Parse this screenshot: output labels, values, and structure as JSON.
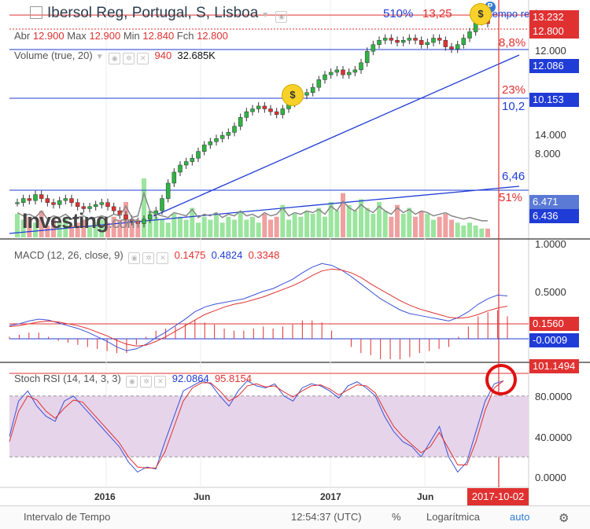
{
  "header": {
    "symbol": "Ibersol Reg, Portugal, S, Lisboa",
    "ohlc": {
      "open_label": "Abr",
      "open": "12.900",
      "high_label": "Max",
      "high": "12.900",
      "low_label": "Min",
      "low": "12.840",
      "close_label": "Fch",
      "close": "12.800"
    },
    "realtime_label": "tempo real",
    "signal_blue": "510%",
    "signal_red": "13,25"
  },
  "volume_study": {
    "label": "Volume (true, 20)",
    "value1": "940",
    "value2": "32.685K"
  },
  "macd_study": {
    "label": "MACD (12, 26, close, 9)",
    "v1": "0.1475",
    "v2": "0.4824",
    "v3": "0.3348"
  },
  "rsi_study": {
    "label": "Stoch RSI (14, 14, 3, 3)",
    "v1": "92.0864",
    "v2": "95.8154"
  },
  "price_annotations": {
    "pct88": "8,8%",
    "pct23": "23%",
    "lvl102": "10,2",
    "lvl646": "6,46",
    "pct51": "51%"
  },
  "price_tags": {
    "t1": "13.232",
    "t2": "12.800",
    "t3": "12.086",
    "t4": "10.153",
    "t5": "6.471",
    "t6": "6.436"
  },
  "price_scale": [
    "14.000",
    "8.000"
  ],
  "price_scale_top": "12.000",
  "macd_scale": [
    "1.0000",
    "0.5000"
  ],
  "macd_tags": {
    "t1": "0.1560",
    "t2": "-0.0009"
  },
  "rsi_scale": [
    "80.0000",
    "40.0000",
    "0.0000"
  ],
  "rsi_tag": "101.1494",
  "x_axis": {
    "labels": [
      "2016",
      "Jun",
      "2017",
      "Jun"
    ],
    "date_tag": "2017-10-02"
  },
  "footer": {
    "interval": "Intervalo de Tempo",
    "time": "12:54:37 (UTC)",
    "percent": "%",
    "log": "Logarítmica",
    "auto": "auto"
  },
  "logo": {
    "main": "Investing",
    "suffix": ".com"
  },
  "colors": {
    "up": "#2fb344",
    "down": "#e03131",
    "blue": "#1f3cd6",
    "macd_line": "#3a52d9",
    "signal_line": "#e03131",
    "rsi_fill": "#e6d4ea"
  },
  "chart_data": {
    "type": "candlestick",
    "title": "Ibersol Reg, Portugal, S, Lisboa",
    "x_range": [
      "2015-09",
      "2017-10-02"
    ],
    "price": [
      6.4,
      6.5,
      6.45,
      6.6,
      6.5,
      6.4,
      6.35,
      6.45,
      6.5,
      6.4,
      6.3,
      6.25,
      6.3,
      6.35,
      6.4,
      6.3,
      6.2,
      6.1,
      6.0,
      5.95,
      5.9,
      6.0,
      6.1,
      6.2,
      6.5,
      6.9,
      7.2,
      7.4,
      7.5,
      7.6,
      7.8,
      8.0,
      8.1,
      8.2,
      8.3,
      8.4,
      8.6,
      8.9,
      9.1,
      9.2,
      9.3,
      9.2,
      9.1,
      9.0,
      9.2,
      9.4,
      9.6,
      9.7,
      9.8,
      10.0,
      10.3,
      10.5,
      10.6,
      10.7,
      10.5,
      10.6,
      10.7,
      11.0,
      11.5,
      11.8,
      12.0,
      12.1,
      12.0,
      11.9,
      12.0,
      12.1,
      12.0,
      11.8,
      11.9,
      12.1,
      12.0,
      11.7,
      11.6,
      11.8,
      12.1,
      12.4,
      12.9,
      13.2,
      12.8
    ],
    "volume": [
      8,
      6,
      7,
      5,
      9,
      4,
      6,
      5,
      7,
      4,
      5,
      6,
      4,
      5,
      6,
      5,
      7,
      6,
      12,
      5,
      6,
      20,
      9,
      7,
      6,
      5,
      8,
      7,
      6,
      10,
      5,
      7,
      6,
      8,
      5,
      7,
      6,
      9,
      6,
      7,
      5,
      8,
      6,
      7,
      11,
      6,
      8,
      7,
      9,
      8,
      10,
      7,
      12,
      9,
      15,
      11,
      9,
      13,
      10,
      8,
      12,
      9,
      7,
      11,
      8,
      10,
      7,
      9,
      8,
      6,
      7,
      8,
      6,
      5,
      4,
      5,
      4,
      3,
      3
    ],
    "macd": [
      0.15,
      0.17,
      0.2,
      0.22,
      0.21,
      0.18,
      0.15,
      0.12,
      0.08,
      0.03,
      -0.02,
      -0.08,
      -0.12,
      -0.1,
      -0.05,
      0.02,
      0.08,
      0.15,
      0.22,
      0.3,
      0.35,
      0.38,
      0.4,
      0.42,
      0.44,
      0.48,
      0.52,
      0.55,
      0.6,
      0.65,
      0.72,
      0.78,
      0.82,
      0.8,
      0.75,
      0.68,
      0.6,
      0.52,
      0.44,
      0.38,
      0.32,
      0.28,
      0.26,
      0.24,
      0.22,
      0.2,
      0.24,
      0.3,
      0.38,
      0.44,
      0.48,
      0.47
    ],
    "signal": [
      0.14,
      0.15,
      0.17,
      0.19,
      0.2,
      0.19,
      0.17,
      0.15,
      0.12,
      0.08,
      0.04,
      -0.01,
      -0.05,
      -0.07,
      -0.06,
      -0.02,
      0.03,
      0.09,
      0.15,
      0.21,
      0.27,
      0.31,
      0.35,
      0.38,
      0.4,
      0.43,
      0.46,
      0.5,
      0.54,
      0.58,
      0.63,
      0.69,
      0.74,
      0.76,
      0.75,
      0.72,
      0.67,
      0.6,
      0.54,
      0.48,
      0.42,
      0.37,
      0.33,
      0.3,
      0.27,
      0.24,
      0.23,
      0.24,
      0.27,
      0.31,
      0.34,
      0.36
    ],
    "stoch_k": [
      40,
      75,
      85,
      70,
      60,
      55,
      75,
      80,
      70,
      60,
      50,
      40,
      30,
      15,
      5,
      10,
      8,
      35,
      60,
      85,
      90,
      95,
      92,
      80,
      70,
      85,
      95,
      90,
      88,
      92,
      80,
      75,
      88,
      92,
      90,
      85,
      78,
      90,
      94,
      88,
      80,
      60,
      45,
      35,
      30,
      20,
      35,
      50,
      20,
      5,
      15,
      45,
      75,
      92,
      95
    ],
    "stoch_d": [
      35,
      65,
      80,
      76,
      65,
      58,
      68,
      76,
      74,
      64,
      54,
      44,
      34,
      20,
      10,
      9,
      9,
      25,
      50,
      75,
      88,
      93,
      93,
      85,
      75,
      80,
      90,
      92,
      89,
      90,
      84,
      79,
      85,
      90,
      91,
      87,
      81,
      86,
      91,
      90,
      83,
      66,
      50,
      40,
      32,
      24,
      30,
      44,
      28,
      12,
      12,
      35,
      66,
      88,
      95
    ],
    "levels": {
      "h1": 13.232,
      "h2": 12.086,
      "h3": 10.153,
      "h4": 6.471,
      "h5": 6.436
    },
    "ylabel": "",
    "xlabel": ""
  }
}
